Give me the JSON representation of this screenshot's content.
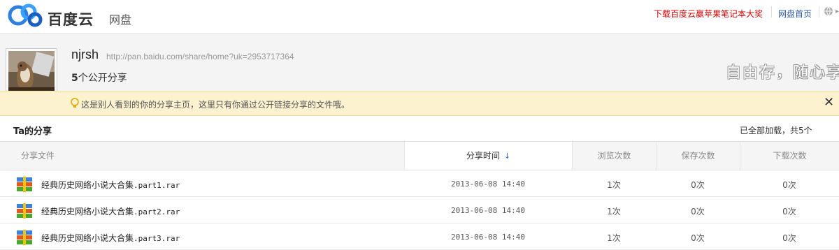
{
  "header": {
    "brand": "百度云",
    "brand_sub": "网盘",
    "promo": "下载百度云赢苹果笔记本大奖",
    "home_link": "网盘首页"
  },
  "profile": {
    "username": "njrsh",
    "share_url": "http://pan.baidu.com/share/home?uk=2953717364",
    "share_count_num": "5",
    "share_count_label": "个公开分享",
    "slogan": "自由存，随心享"
  },
  "notice": {
    "text": "这是别人看到的你的分享主页，这里只有你通过公开链接分享的文件哦。"
  },
  "section": {
    "title": "Ta的分享",
    "loaded_text": "已全部加载，共5个"
  },
  "table": {
    "columns": {
      "name": "分享文件",
      "time": "分享时间",
      "views": "浏览次数",
      "saves": "保存次数",
      "downloads": "下载次数"
    },
    "rows": [
      {
        "name_cn": "经典历史网络小说大合集",
        "name_ext": ".part1.rar",
        "time": "2013-06-08 14:40",
        "views": "1次",
        "saves": "0次",
        "downloads": "0次"
      },
      {
        "name_cn": "经典历史网络小说大合集",
        "name_ext": ".part2.rar",
        "time": "2013-06-08 14:40",
        "views": "1次",
        "saves": "0次",
        "downloads": "0次"
      },
      {
        "name_cn": "经典历史网络小说大合集",
        "name_ext": ".part3.rar",
        "time": "2013-06-08 14:40",
        "views": "1次",
        "saves": "0次",
        "downloads": "0次"
      }
    ]
  },
  "colors": {
    "promo": "#cc0000",
    "link": "#2b5a9a",
    "notice_bg": "#fcf2d0",
    "sort_arrow": "#2b6cc4"
  },
  "icons": [
    "baidu-cloud-logo-icon",
    "globe-icon",
    "lightbulb-icon",
    "close-icon",
    "sort-down-icon",
    "rar-file-icon"
  ]
}
